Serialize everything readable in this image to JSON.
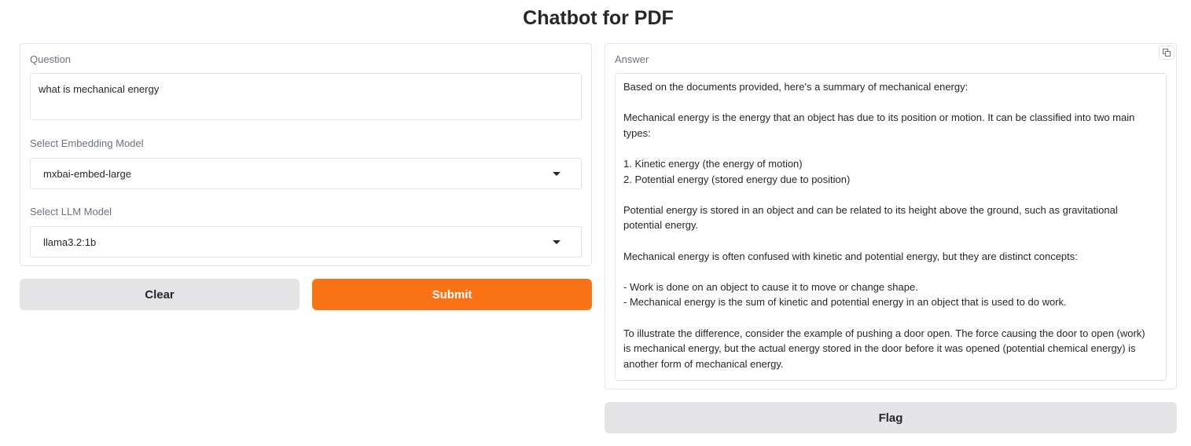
{
  "page": {
    "title": "Chatbot for PDF"
  },
  "left": {
    "question_label": "Question",
    "question_value": "what is mechanical energy",
    "embedding_label": "Select Embedding Model",
    "embedding_value": "mxbai-embed-large",
    "llm_label": "Select LLM Model",
    "llm_value": "llama3.2:1b"
  },
  "buttons": {
    "clear": "Clear",
    "submit": "Submit",
    "flag": "Flag"
  },
  "answer": {
    "label": "Answer",
    "copy_icon": "copy-icon",
    "lines": [
      "Based on the documents provided, here's a summary of mechanical energy:",
      "",
      "Mechanical energy is the energy that an object has due to its position or motion. It can be classified into two main",
      "types:",
      "",
      "1. Kinetic energy (the energy of motion)",
      "2. Potential energy (stored energy due to position)",
      "",
      "Potential energy is stored in an object and can be related to its height above the ground, such as gravitational",
      "potential energy.",
      "",
      "Mechanical energy is often confused with kinetic and potential energy, but they are distinct concepts:",
      "",
      "- Work is done on an object to cause it to move or change shape.",
      "- Mechanical energy is the sum of kinetic and potential energy in an object that is used to do work.",
      "",
      "To illustrate the difference, consider the example of pushing a door open. The force causing the door to open (work)",
      "is mechanical energy, but the actual energy stored in the door before it was opened (potential chemical energy) is",
      "another form of mechanical energy."
    ]
  },
  "colors": {
    "accent": "#f97316",
    "secondary_button": "#e4e4e7",
    "border": "#e4e4e7",
    "label": "#6b7280"
  }
}
